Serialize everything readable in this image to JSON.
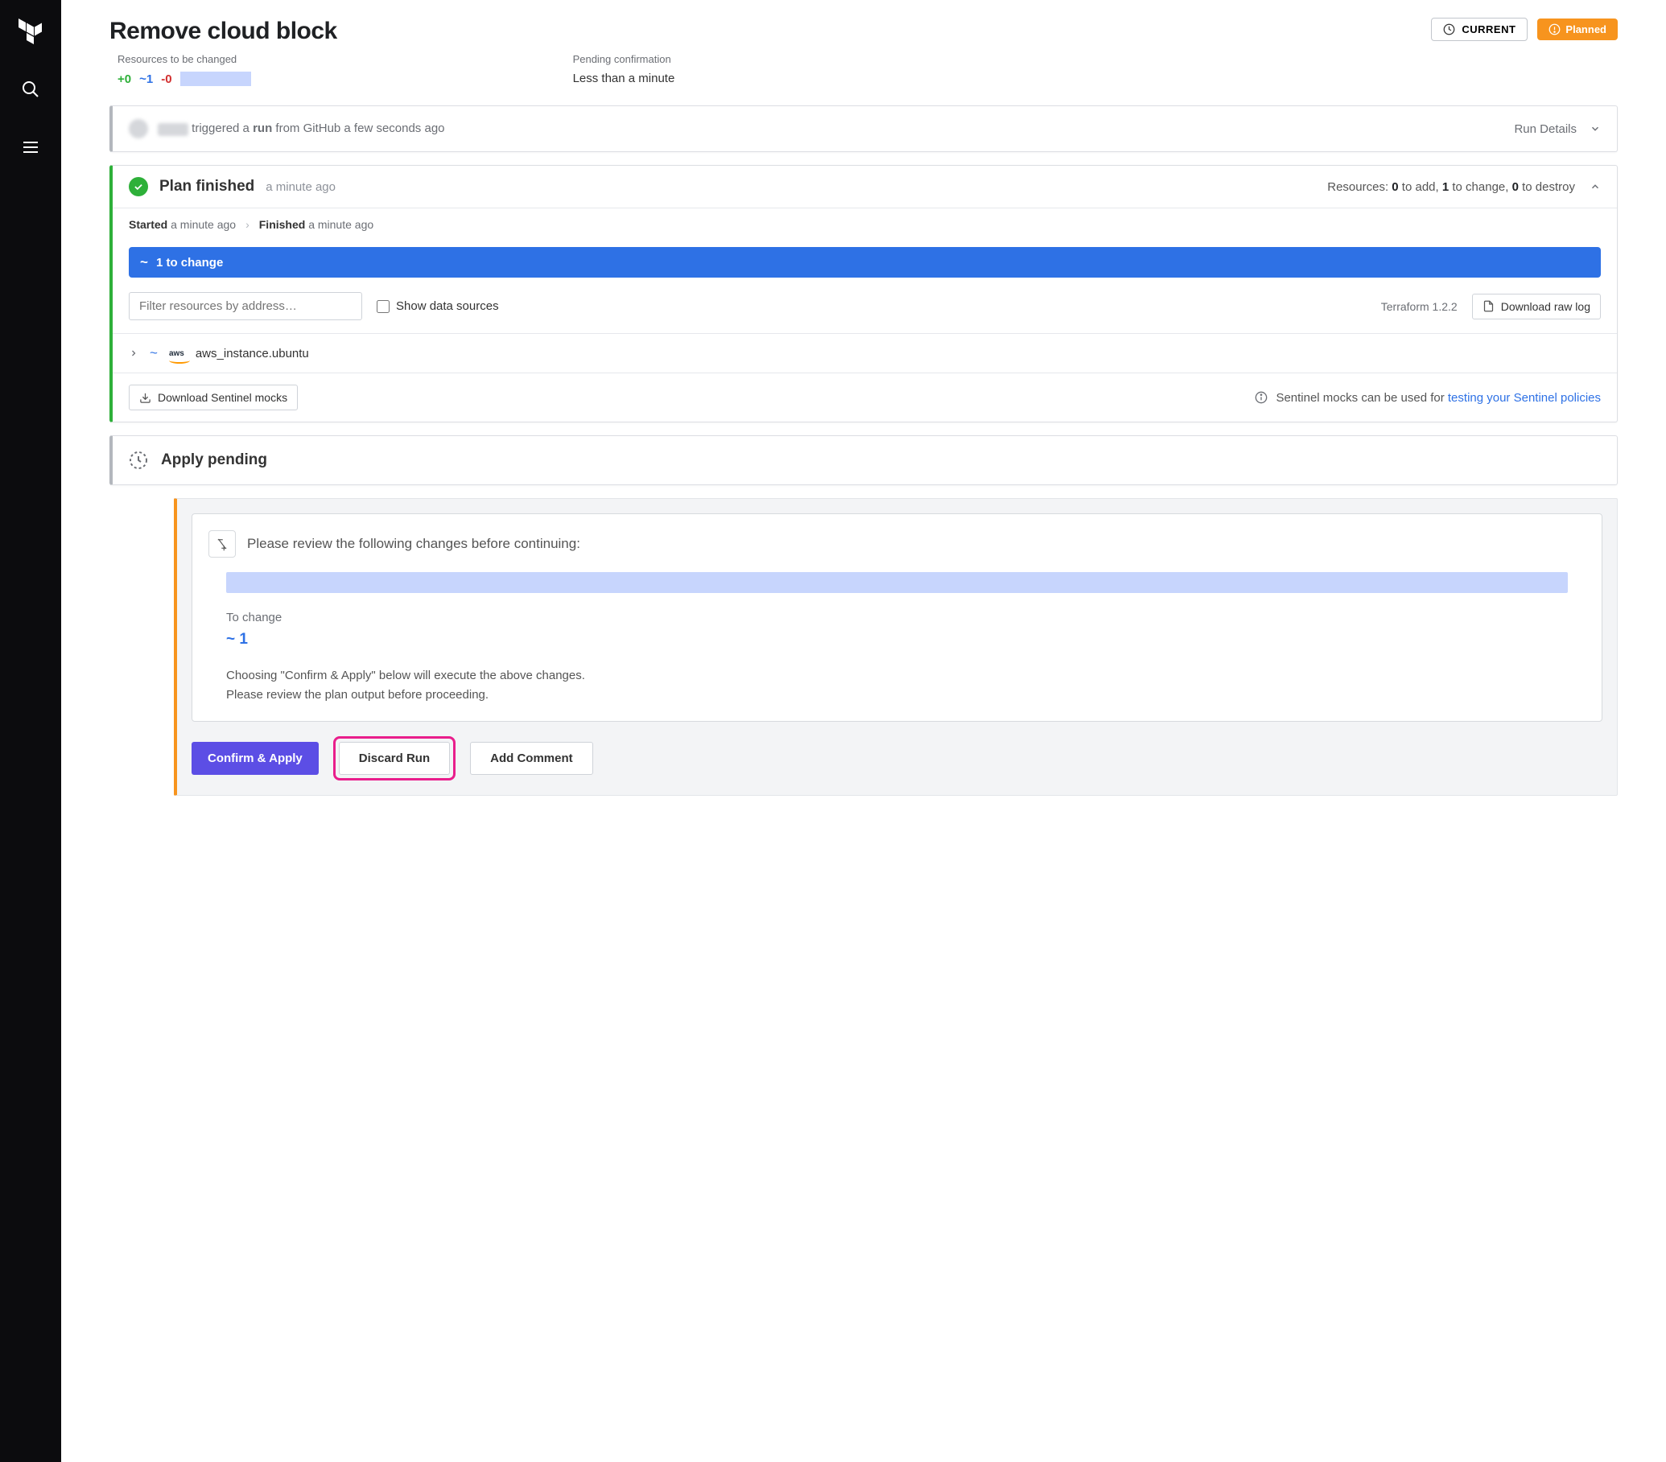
{
  "title": "Remove cloud block",
  "buttons": {
    "current": "CURRENT",
    "planned": "Planned"
  },
  "meta": {
    "resources_label": "Resources to be changed",
    "add": "+0",
    "change": "~1",
    "destroy": "-0",
    "pending_label": "Pending confirmation",
    "pending_value": "Less than a minute"
  },
  "trigger": {
    "text_prefix": " triggered a ",
    "run_word": "run",
    "text_suffix": " from GitHub a few seconds ago",
    "details": "Run Details"
  },
  "plan": {
    "title": "Plan finished",
    "time": "a minute ago",
    "summary_prefix": "Resources: ",
    "summary_add": "0",
    "summary_add_suffix": " to add, ",
    "summary_change": "1",
    "summary_change_suffix": " to change, ",
    "summary_destroy": "0",
    "summary_destroy_suffix": " to destroy",
    "started_label": "Started",
    "started_time": " a minute ago",
    "finished_label": "Finished",
    "finished_time": " a minute ago",
    "blue_bar": "1 to change",
    "filter_placeholder": "Filter resources by address…",
    "show_data": "Show data sources",
    "tf_version": "Terraform 1.2.2",
    "download_log": "Download raw log",
    "resource_name": "aws_instance.ubuntu",
    "download_mocks": "Download Sentinel mocks",
    "sentinel_info_prefix": "Sentinel mocks can be used for ",
    "sentinel_link": "testing your Sentinel policies"
  },
  "apply": {
    "title": "Apply pending"
  },
  "confirm": {
    "title": "Please review the following changes before continuing:",
    "to_change_label": "To change",
    "to_change_value": "~ 1",
    "line1": "Choosing \"Confirm & Apply\" below will execute the above changes.",
    "line2": "Please review the plan output before proceeding.",
    "btn_confirm": "Confirm & Apply",
    "btn_discard": "Discard Run",
    "btn_comment": "Add Comment"
  }
}
